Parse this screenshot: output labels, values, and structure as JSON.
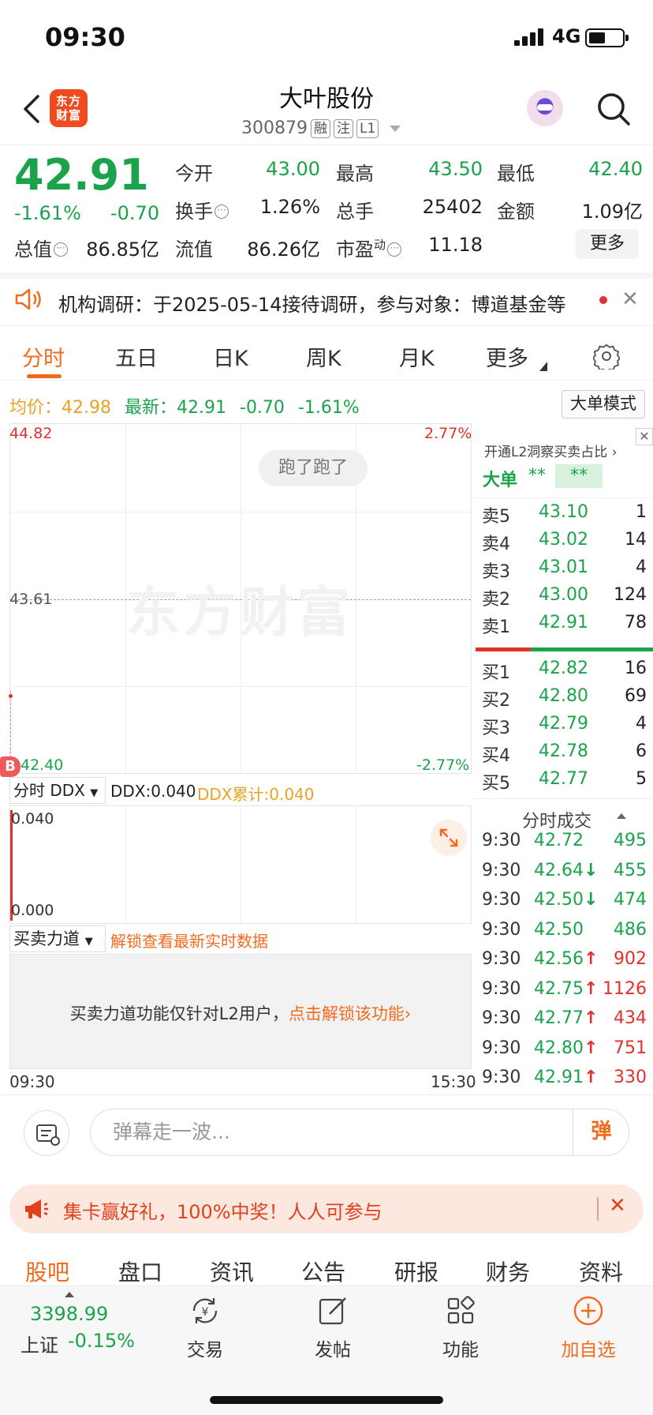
{
  "status_bar": {
    "time": "09:30",
    "network": "4G"
  },
  "header": {
    "logo_text": "东方\n财富",
    "stock_name": "大叶股份",
    "stock_code": "300879",
    "tags": [
      "融",
      "注",
      "L1"
    ]
  },
  "quote": {
    "price": "42.91",
    "change_pct": "-1.61%",
    "change_amt": "-0.70",
    "fields": {
      "open_label": "今开",
      "open": "43.00",
      "high_label": "最高",
      "high": "43.50",
      "low_label": "最低",
      "low": "42.40",
      "turnover_label": "换手",
      "turnover": "1.26%",
      "volume_label": "总手",
      "volume": "25402",
      "amount_label": "金额",
      "amount": "1.09亿",
      "mcap_label": "总值",
      "mcap": "86.85亿",
      "float_label": "流值",
      "float": "86.26亿",
      "pe_label": "市盈",
      "pe_sup": "动",
      "pe": "11.18"
    },
    "more_label": "更多"
  },
  "notice": {
    "text": "机构调研：于2025-05-14接待调研，参与对象：博道基金等"
  },
  "period_tabs": [
    "分时",
    "五日",
    "日K",
    "周K",
    "月K",
    "更多"
  ],
  "info_line": {
    "avg_label": "均价：",
    "avg": "42.98",
    "latest_label": "最新：",
    "latest": "42.91",
    "change": "-0.70",
    "change_pct": "-1.61%",
    "mode_button": "大单模式"
  },
  "chart": {
    "y_top": "44.82",
    "y_mid": "43.61",
    "y_bottom": "42.40",
    "pct_top": "2.77%",
    "pct_bottom": "-2.77%",
    "watermark": "东方财富",
    "danmaku": "跑了跑了",
    "marker": "B"
  },
  "ddx": {
    "select": "分时 DDX",
    "ddx_label": "DDX:0.040",
    "ddx_cum_label": "DDX累计:0.040",
    "y_top": "0.040",
    "y_bottom": "0.000"
  },
  "force": {
    "select": "买卖力道",
    "unlock_link": "解锁查看最新实时数据",
    "message": "买卖力道功能仅针对L2用户，",
    "unlock_cta": "点击解锁该功能",
    "time_start": "09:30",
    "time_end": "15:30"
  },
  "order_book": {
    "l2_link": "开通L2洞察买卖占比",
    "big_order_label": "大单",
    "big_order_v1": "**",
    "big_order_v2": "**",
    "buy_ratio": 0.31,
    "asks": [
      {
        "label": "卖5",
        "price": "43.10",
        "vol": "1"
      },
      {
        "label": "卖4",
        "price": "43.02",
        "vol": "14"
      },
      {
        "label": "卖3",
        "price": "43.01",
        "vol": "4"
      },
      {
        "label": "卖2",
        "price": "43.00",
        "vol": "124"
      },
      {
        "label": "卖1",
        "price": "42.91",
        "vol": "78"
      }
    ],
    "bids": [
      {
        "label": "买1",
        "price": "42.82",
        "vol": "16"
      },
      {
        "label": "买2",
        "price": "42.80",
        "vol": "69"
      },
      {
        "label": "买3",
        "price": "42.79",
        "vol": "4"
      },
      {
        "label": "买4",
        "price": "42.78",
        "vol": "6"
      },
      {
        "label": "买5",
        "price": "42.77",
        "vol": "5"
      }
    ],
    "trades_title": "分时成交",
    "trades": [
      {
        "time": "9:30",
        "price": "42.72",
        "arrow": "",
        "vol": "495",
        "dir": "green"
      },
      {
        "time": "9:30",
        "price": "42.64",
        "arrow": "↓",
        "vol": "455",
        "dir": "green"
      },
      {
        "time": "9:30",
        "price": "42.50",
        "arrow": "↓",
        "vol": "474",
        "dir": "green"
      },
      {
        "time": "9:30",
        "price": "42.50",
        "arrow": "",
        "vol": "486",
        "dir": "green"
      },
      {
        "time": "9:30",
        "price": "42.56",
        "arrow": "↑",
        "vol": "902",
        "dir": "red"
      },
      {
        "time": "9:30",
        "price": "42.75",
        "arrow": "↑",
        "vol": "1126",
        "dir": "red"
      },
      {
        "time": "9:30",
        "price": "42.77",
        "arrow": "↑",
        "vol": "434",
        "dir": "red"
      },
      {
        "time": "9:30",
        "price": "42.80",
        "arrow": "↑",
        "vol": "751",
        "dir": "red"
      },
      {
        "time": "9:30",
        "price": "42.91",
        "arrow": "↑",
        "vol": "330",
        "dir": "red"
      }
    ]
  },
  "danmaku_input": {
    "placeholder": "弹幕走一波...",
    "send": "弹"
  },
  "promo": {
    "text": "集卡赢好礼，100%中奖！人人可参与"
  },
  "section_tabs": [
    "股吧",
    "盘口",
    "资讯",
    "公告",
    "研报",
    "财务",
    "资料"
  ],
  "bottom_nav": {
    "index_value": "3398.99",
    "index_name": "上证",
    "index_change": "-0.15%",
    "items": [
      "交易",
      "发帖",
      "功能",
      "加自选"
    ]
  },
  "colors": {
    "up": "#e0312c",
    "down": "#1aa34a",
    "accent": "#f26b1d",
    "avg": "#e8a321"
  }
}
